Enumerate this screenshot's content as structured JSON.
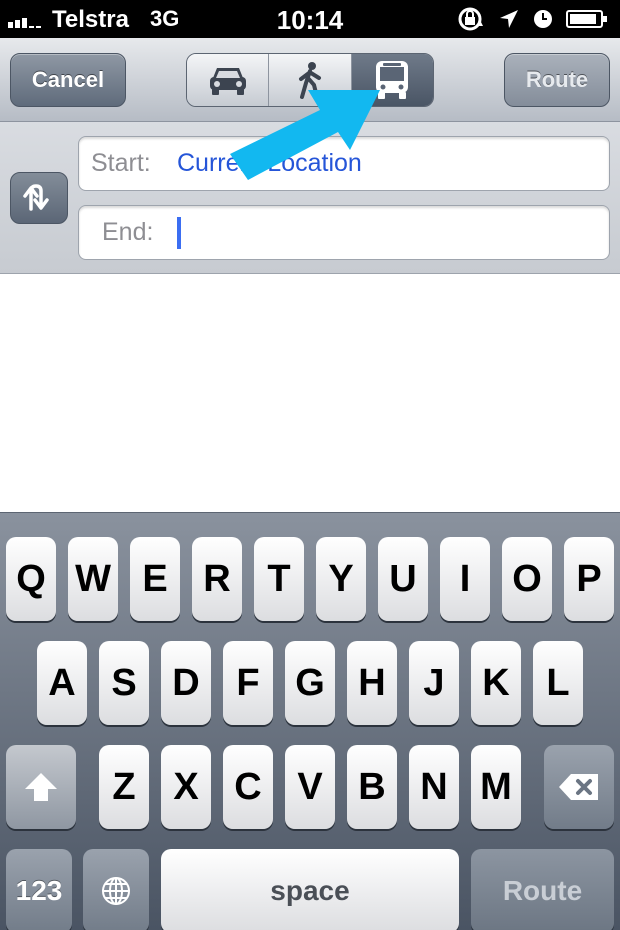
{
  "status_bar": {
    "carrier": "Telstra",
    "network": "3G",
    "time": "10:14"
  },
  "nav": {
    "cancel_label": "Cancel",
    "route_label": "Route",
    "modes": [
      {
        "name": "car-icon",
        "active": false
      },
      {
        "name": "walking-icon",
        "active": false
      },
      {
        "name": "bus-icon",
        "active": true
      }
    ]
  },
  "form": {
    "start_label": "Start:",
    "start_value": "Current Location",
    "end_label": "End:",
    "end_value": ""
  },
  "keyboard": {
    "row1": [
      "Q",
      "W",
      "E",
      "R",
      "T",
      "Y",
      "U",
      "I",
      "O",
      "P"
    ],
    "row2": [
      "A",
      "S",
      "D",
      "F",
      "G",
      "H",
      "J",
      "K",
      "L"
    ],
    "row3": [
      "Z",
      "X",
      "C",
      "V",
      "B",
      "N",
      "M"
    ],
    "numbers_label": "123",
    "space_label": "space",
    "route_label": "Route"
  },
  "colors": {
    "accent_text": "#2555d8",
    "arrow": "#12b8f0"
  }
}
